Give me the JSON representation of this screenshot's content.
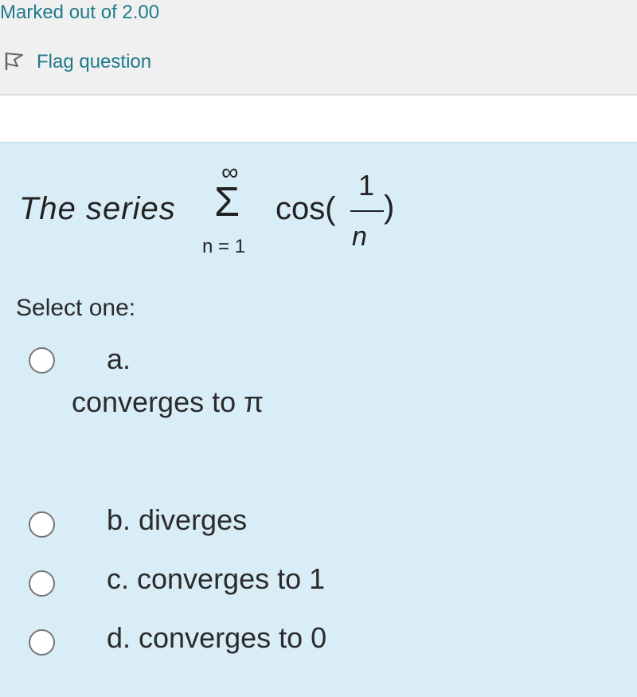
{
  "info": {
    "marked_text": "Marked out of 2.00",
    "flag_label": "Flag question",
    "flag_icon": "flag-icon"
  },
  "question": {
    "formula": {
      "lead_text": "The series",
      "upper_limit": "∞",
      "sigma": "Σ",
      "lower_limit": "n = 1",
      "function": "cos(",
      "numerator": "1",
      "denominator": "n",
      "close_paren": ")"
    },
    "select_one": "Select one:",
    "options": [
      {
        "label": "a.",
        "text": "converges to π",
        "selected": false
      },
      {
        "text": "b. diverges",
        "selected": false
      },
      {
        "text": "c. converges to 1",
        "selected": false
      },
      {
        "text": "d. converges to 0",
        "selected": false
      }
    ]
  },
  "colors": {
    "link": "#1f7a8c",
    "content_bg": "#d9edf7",
    "info_bg": "#f0f0f0"
  }
}
